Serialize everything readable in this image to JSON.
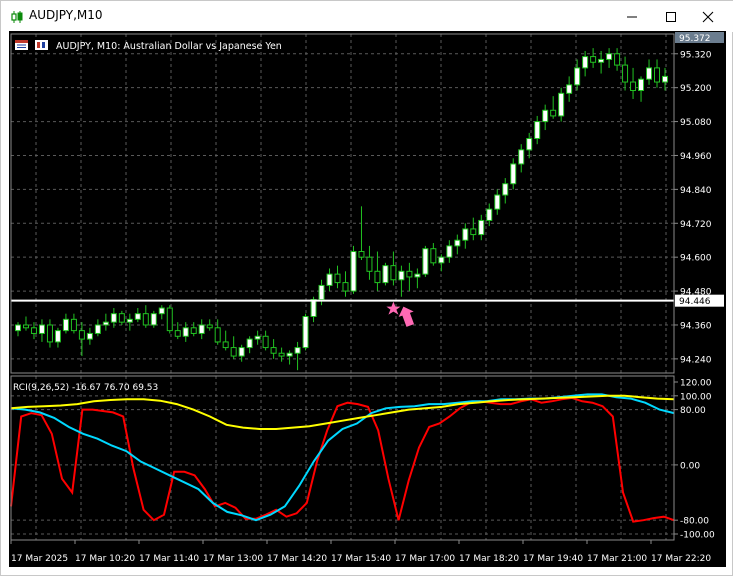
{
  "window": {
    "title": "AUDJPY,M10",
    "minimize_icon": "minimize-icon",
    "maximize_icon": "maximize-icon",
    "close_icon": "close-icon"
  },
  "chart_header": {
    "text": "AUDJPY, M10:  Australian Dollar vs Japanese Yen"
  },
  "colors": {
    "background": "#000000",
    "grid": "#5a5a5a",
    "bull_body": "#ffffff",
    "candle": "#22c322",
    "hline": "#ffffff",
    "arrow": "#ff69b4",
    "rci_short": "#ff0000",
    "rci_mid": "#00d8ff",
    "rci_long": "#ffff00",
    "axis_text": "#ffffff"
  },
  "price_axis": {
    "ticks": [
      "95.320",
      "95.200",
      "95.080",
      "94.960",
      "94.840",
      "94.720",
      "94.600",
      "94.480",
      "94.360",
      "94.240"
    ],
    "current_price": "95.372",
    "hline_price": "94.446"
  },
  "indicator": {
    "label": "RCI(9,26,52) -16.67 76.70 69.53",
    "ticks": [
      "120.00",
      "100.00",
      "80.00",
      "0.00",
      "-80.00",
      "-100.00"
    ]
  },
  "time_axis": {
    "ticks": [
      "17 Mar 2025",
      "17 Mar 10:20",
      "17 Mar 11:40",
      "17 Mar 13:00",
      "17 Mar 14:20",
      "17 Mar 15:40",
      "17 Mar 17:00",
      "17 Mar 18:20",
      "17 Mar 19:40",
      "17 Mar 21:00",
      "17 Mar 22:20"
    ]
  },
  "chart_data": {
    "type": "candlestick",
    "symbol": "AUDJPY",
    "timeframe": "M10",
    "ylim": [
      94.19,
      95.39
    ],
    "hline": 94.446,
    "arrow_signal": {
      "candle_index": 47,
      "direction": "buy"
    },
    "candles": [
      [
        94.34,
        94.37,
        94.32,
        94.36
      ],
      [
        94.36,
        94.39,
        94.34,
        94.35
      ],
      [
        94.35,
        94.37,
        94.31,
        94.33
      ],
      [
        94.33,
        94.38,
        94.3,
        94.36
      ],
      [
        94.36,
        94.38,
        94.28,
        94.3
      ],
      [
        94.3,
        94.35,
        94.28,
        94.34
      ],
      [
        94.34,
        94.4,
        94.33,
        94.38
      ],
      [
        94.38,
        94.4,
        94.33,
        94.34
      ],
      [
        94.34,
        94.37,
        94.25,
        94.31
      ],
      [
        94.31,
        94.35,
        94.29,
        94.33
      ],
      [
        94.33,
        94.38,
        94.32,
        94.36
      ],
      [
        94.36,
        94.4,
        94.34,
        94.37
      ],
      [
        94.37,
        94.42,
        94.35,
        94.4
      ],
      [
        94.4,
        94.41,
        94.36,
        94.37
      ],
      [
        94.37,
        94.4,
        94.34,
        94.38
      ],
      [
        94.38,
        94.42,
        94.37,
        94.4
      ],
      [
        94.4,
        94.43,
        94.35,
        94.36
      ],
      [
        94.36,
        94.41,
        94.35,
        94.4
      ],
      [
        94.4,
        94.43,
        94.38,
        94.42
      ],
      [
        94.42,
        94.43,
        94.33,
        94.34
      ],
      [
        94.34,
        94.37,
        94.31,
        94.32
      ],
      [
        94.32,
        94.37,
        94.3,
        94.35
      ],
      [
        94.35,
        94.37,
        94.32,
        94.33
      ],
      [
        94.33,
        94.38,
        94.31,
        94.36
      ],
      [
        94.36,
        94.38,
        94.34,
        94.35
      ],
      [
        94.35,
        94.38,
        94.29,
        94.3
      ],
      [
        94.3,
        94.34,
        94.27,
        94.28
      ],
      [
        94.28,
        94.32,
        94.24,
        94.25
      ],
      [
        94.25,
        94.29,
        94.23,
        94.28
      ],
      [
        94.28,
        94.32,
        94.26,
        94.31
      ],
      [
        94.31,
        94.34,
        94.29,
        94.32
      ],
      [
        94.32,
        94.34,
        94.27,
        94.28
      ],
      [
        94.28,
        94.31,
        94.24,
        94.26
      ],
      [
        94.26,
        94.28,
        94.23,
        94.25
      ],
      [
        94.25,
        94.27,
        94.22,
        94.26
      ],
      [
        94.26,
        94.3,
        94.2,
        94.28
      ],
      [
        94.28,
        94.4,
        94.27,
        94.39
      ],
      [
        94.39,
        94.46,
        94.37,
        94.45
      ],
      [
        94.45,
        94.52,
        94.43,
        94.5
      ],
      [
        94.5,
        94.56,
        94.48,
        94.54
      ],
      [
        94.54,
        94.57,
        94.49,
        94.51
      ],
      [
        94.51,
        94.55,
        94.46,
        94.48
      ],
      [
        94.48,
        94.64,
        94.47,
        94.62
      ],
      [
        94.62,
        94.78,
        94.59,
        94.6
      ],
      [
        94.6,
        94.64,
        94.52,
        94.55
      ],
      [
        94.55,
        94.62,
        94.48,
        94.51
      ],
      [
        94.51,
        94.58,
        94.5,
        94.57
      ],
      [
        94.57,
        94.62,
        94.5,
        94.52
      ],
      [
        94.52,
        94.57,
        94.46,
        94.55
      ],
      [
        94.55,
        94.58,
        94.48,
        94.53
      ],
      [
        94.53,
        94.56,
        94.49,
        94.54
      ],
      [
        94.54,
        94.64,
        94.53,
        94.63
      ],
      [
        94.63,
        94.65,
        94.57,
        94.58
      ],
      [
        94.58,
        94.61,
        94.55,
        94.6
      ],
      [
        94.6,
        94.66,
        94.58,
        94.64
      ],
      [
        94.64,
        94.68,
        94.61,
        94.66
      ],
      [
        94.66,
        94.72,
        94.63,
        94.7
      ],
      [
        94.7,
        94.74,
        94.66,
        94.68
      ],
      [
        94.68,
        94.75,
        94.66,
        94.73
      ],
      [
        94.73,
        94.79,
        94.71,
        94.77
      ],
      [
        94.77,
        94.84,
        94.75,
        94.82
      ],
      [
        94.82,
        94.88,
        94.79,
        94.86
      ],
      [
        94.86,
        94.95,
        94.84,
        94.93
      ],
      [
        94.93,
        95.0,
        94.9,
        94.98
      ],
      [
        94.98,
        95.04,
        94.95,
        95.02
      ],
      [
        95.02,
        95.1,
        95.0,
        95.08
      ],
      [
        95.08,
        95.14,
        95.05,
        95.12
      ],
      [
        95.12,
        95.17,
        95.09,
        95.1
      ],
      [
        95.1,
        95.2,
        95.08,
        95.18
      ],
      [
        95.18,
        95.24,
        95.15,
        95.21
      ],
      [
        95.21,
        95.3,
        95.19,
        95.27
      ],
      [
        95.27,
        95.33,
        95.24,
        95.31
      ],
      [
        95.31,
        95.34,
        95.27,
        95.29
      ],
      [
        95.29,
        95.33,
        95.25,
        95.3
      ],
      [
        95.3,
        95.34,
        95.27,
        95.32
      ],
      [
        95.32,
        95.34,
        95.26,
        95.28
      ],
      [
        95.28,
        95.31,
        95.19,
        95.22
      ],
      [
        95.22,
        95.27,
        95.16,
        95.19
      ],
      [
        95.19,
        95.24,
        95.15,
        95.23
      ],
      [
        95.23,
        95.3,
        95.21,
        95.27
      ],
      [
        95.27,
        95.3,
        95.2,
        95.22
      ],
      [
        95.22,
        95.27,
        95.19,
        95.24
      ]
    ],
    "rci_series": [
      {
        "name": "RCI 9",
        "color": "#ff0000",
        "values": [
          -60,
          70,
          75,
          72,
          45,
          -20,
          -40,
          80,
          80,
          78,
          76,
          70,
          -5,
          -65,
          -80,
          -72,
          -10,
          -10,
          -15,
          -35,
          -60,
          -55,
          -62,
          -78,
          -78,
          -72,
          -65,
          -75,
          -70,
          -55,
          5,
          50,
          85,
          90,
          88,
          84,
          50,
          -20,
          -80,
          -22,
          25,
          55,
          60,
          70,
          82,
          90,
          92,
          90,
          88,
          88,
          92,
          95,
          90,
          92,
          95,
          97,
          92,
          90,
          85,
          70,
          -40,
          -82,
          -80,
          -77,
          -75,
          -80
        ]
      },
      {
        "name": "RCI 26",
        "color": "#00d8ff",
        "values": [
          82,
          80,
          76,
          68,
          55,
          45,
          38,
          28,
          20,
          5,
          -5,
          -15,
          -25,
          -35,
          -55,
          -68,
          -73,
          -80,
          -72,
          -60,
          -30,
          5,
          35,
          52,
          60,
          75,
          82,
          84,
          85,
          88,
          88,
          90,
          92,
          92,
          95,
          95,
          96,
          96,
          98,
          100,
          102,
          102,
          98,
          96,
          90,
          80,
          75
        ]
      },
      {
        "name": "RCI 52",
        "color": "#ffff00",
        "values": [
          82,
          84,
          85,
          86,
          88,
          92,
          94,
          95,
          95,
          93,
          88,
          80,
          70,
          58,
          54,
          52,
          52,
          54,
          56,
          60,
          64,
          68,
          72,
          76,
          80,
          82,
          84,
          88,
          90,
          92,
          94,
          95,
          96,
          97,
          98,
          99,
          100,
          100,
          98,
          96,
          95
        ]
      }
    ]
  }
}
